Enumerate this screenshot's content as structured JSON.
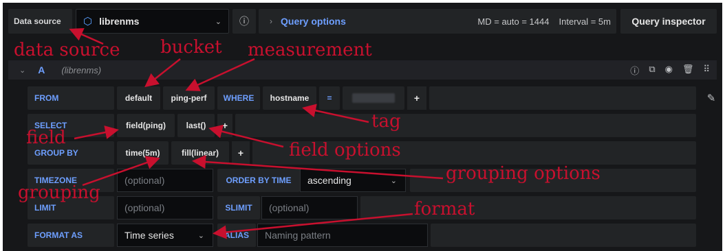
{
  "toolbar": {
    "data_source_label": "Data source",
    "data_source_value": "librenms",
    "query_options_label": "Query options",
    "md_text": "MD = auto = 1444",
    "interval_text": "Interval = 5m",
    "query_inspector_label": "Query inspector"
  },
  "query_row": {
    "letter": "A",
    "source": "(librenms)"
  },
  "builder": {
    "from_label": "FROM",
    "from_bucket": "default",
    "from_measurement": "ping-perf",
    "where_label": "WHERE",
    "where_tag": "hostname",
    "where_operator": "=",
    "plus": "+",
    "select_label": "SELECT",
    "select_field": "field(ping)",
    "select_fn": "last()",
    "group_by_label": "GROUP BY",
    "group_time": "time(5m)",
    "group_fill": "fill(linear)",
    "timezone_label": "TIMEZONE",
    "timezone_placeholder": "(optional)",
    "order_label": "ORDER BY TIME",
    "order_value": "ascending",
    "limit_label": "LIMIT",
    "limit_placeholder": "(optional)",
    "slimit_label": "SLIMIT",
    "slimit_placeholder": "(optional)",
    "format_label": "FORMAT AS",
    "format_value": "Time series",
    "alias_label": "ALIAS",
    "alias_placeholder": "Naming pattern"
  },
  "annotations": {
    "data_source": "data source",
    "bucket": "bucket",
    "measurement": "measurement",
    "tag": "tag",
    "field": "field",
    "field_options": "field options",
    "grouping": "grouping",
    "grouping_options": "grouping options",
    "format": "format"
  },
  "colors": {
    "annotation": "#c8102e",
    "keyword": "#6e9fff",
    "background": "#161719"
  }
}
